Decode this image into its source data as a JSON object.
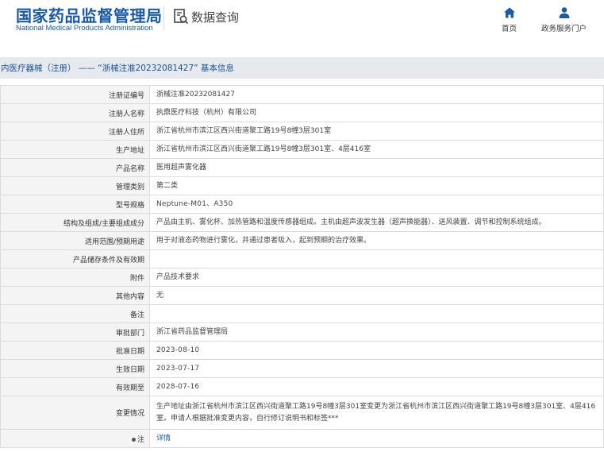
{
  "header": {
    "logo_cn": "国家药品监督管理局",
    "logo_en": "National Medical Products Administration",
    "query_title": "数据查询",
    "nav": [
      {
        "label": "首页",
        "icon": "home-icon"
      },
      {
        "label": "政务服务门户",
        "icon": "user-icon"
      }
    ],
    "brand_color": "#1a5aa8"
  },
  "titlebar": {
    "text": "内医疗器械（注册） —— “浙械注准20232081427” 基本信息"
  },
  "rows": [
    {
      "label": "注册证编号",
      "value": "浙械注准20232081427"
    },
    {
      "label": "注册人名称",
      "value": "执鼎医疗科技（杭州）有限公司"
    },
    {
      "label": "注册人住所",
      "value": "浙江省杭州市滨江区西兴街道聚工路19号8幢3层301室"
    },
    {
      "label": "生产地址",
      "value": "浙江省杭州市滨江区西兴街道聚工路19号8幢3层301室、4层416室"
    },
    {
      "label": "产品名称",
      "value": "医用超声雾化器"
    },
    {
      "label": "管理类别",
      "value": "第二类"
    },
    {
      "label": "型号规格",
      "value": "Neptune-M01、A350"
    },
    {
      "label": "结构及组成/主要组成成分",
      "value": "产品由主机、雾化杯、加热管路和温度传感器组成。主机由超声波发生器（超声换能器）、送风装置、调节和控制系统组成。"
    },
    {
      "label": "适用范围/预期用途",
      "value": "用于对液态药物进行雾化，并通过患者吸入，起到预期的治疗效果。"
    },
    {
      "label": "产品储存条件及有效期",
      "value": ""
    },
    {
      "label": "附件",
      "value": "产品技术要求"
    },
    {
      "label": "其他内容",
      "value": "无"
    },
    {
      "label": "备注",
      "value": ""
    },
    {
      "label": "审批部门",
      "value": "浙江省药品监督管理局"
    },
    {
      "label": "批准日期",
      "value": "2023-08-10"
    },
    {
      "label": "生效日期",
      "value": "2023-07-17"
    },
    {
      "label": "有效期至",
      "value": "2028-07-16"
    },
    {
      "label": "变更情况",
      "value": "生产地址由浙江省杭州市滨江区西兴街道聚工路19号8幢3层301室变更为浙江省杭州市滨江区西兴街道聚工路19号8幢3层301室、4层416室。申请人根据批准变更内容，自行修订说明书和标签***"
    },
    {
      "label": "注",
      "value": "详情"
    }
  ],
  "note_icon": "info-dot-icon"
}
